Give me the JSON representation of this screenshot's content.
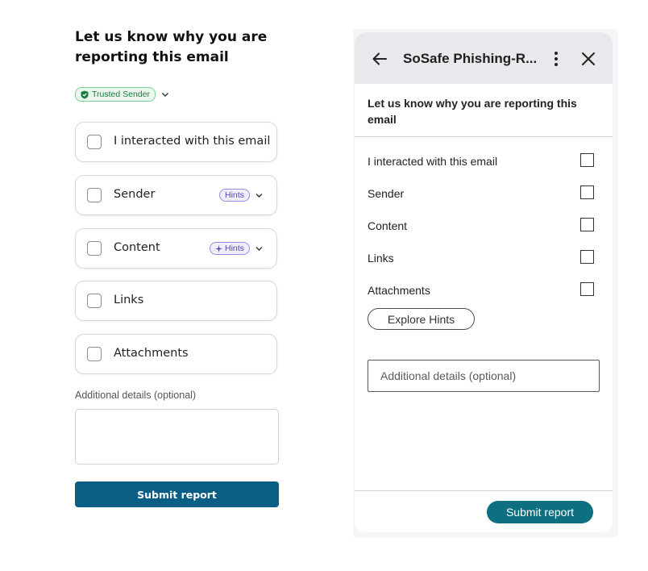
{
  "left_panel": {
    "title": "Let us know why you are reporting this email",
    "trusted_badge": "Trusted Sender",
    "options": [
      {
        "label": "I interacted with this email"
      },
      {
        "label": "Sender",
        "hints": "Hints"
      },
      {
        "label": "Content",
        "hints": "Hints"
      },
      {
        "label": "Links"
      },
      {
        "label": "Attachments"
      }
    ],
    "additional_label": "Additional details (optional)",
    "submit_label": "Submit report"
  },
  "right_panel": {
    "header_title": "SoSafe Phishing-R...",
    "heading": "Let us know why you are reporting this email",
    "items": [
      {
        "label": "I interacted with this email"
      },
      {
        "label": "Sender"
      },
      {
        "label": "Content"
      },
      {
        "label": "Links"
      },
      {
        "label": "Attachments"
      }
    ],
    "explore_label": "Explore Hints",
    "additional_placeholder": "Additional details (optional)",
    "submit_label": "Submit report"
  },
  "colors": {
    "left_submit": "#0a5e85",
    "right_submit": "#0d6f80",
    "trusted_green": "#1d7a3e",
    "hints_purple": "#5a3fc0",
    "header_bg": "#e7e9ec"
  },
  "icons": {
    "trusted": "shield-check-icon",
    "dropdown": "chevron-down-icon",
    "hints": "sparkle-icon",
    "back": "arrow-left-icon",
    "more": "more-vertical-icon",
    "close": "close-icon"
  }
}
